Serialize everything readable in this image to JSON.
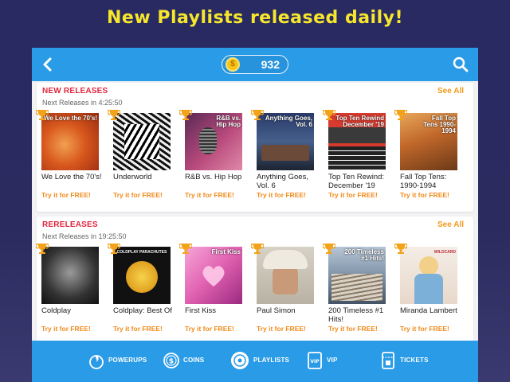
{
  "banner": {
    "text": "New Playlists released daily!"
  },
  "topbar": {
    "coins": "932",
    "coin_symbol": "$"
  },
  "sections": [
    {
      "title": "NEW RELEASES",
      "see_all": "See All",
      "next": "Next Releases in 4:25:50",
      "items": [
        {
          "title": "We Love the 70's!",
          "cta": "Try it for FREE!",
          "art": "We Love the 70's!"
        },
        {
          "title": "Underworld",
          "cta": "Try it for FREE!",
          "art": ""
        },
        {
          "title": "R&B vs. Hip Hop",
          "cta": "Try it for FREE!",
          "art": "R&B vs. Hip Hop"
        },
        {
          "title": "Anything Goes, Vol. 6",
          "cta": "Try it for FREE!",
          "art": "Anything Goes, Vol. 6"
        },
        {
          "title": "Top Ten Rewind: December '19",
          "cta": "Try it for FREE!",
          "art": "Top Ten Rewind December '19"
        },
        {
          "title": "Fall Top Tens: 1990-1994",
          "cta": "Try it for FREE!",
          "art": "Fall Top Tens 1990-1994"
        }
      ]
    },
    {
      "title": "RERELEASES",
      "see_all": "See All",
      "next": "Next Releases in 19:25:50",
      "items": [
        {
          "title": "Coldplay",
          "cta": "Try it for FREE!",
          "art": ""
        },
        {
          "title": "Coldplay: Best Of",
          "cta": "Try it for FREE!",
          "art": "COLDPLAY PARACHUTES"
        },
        {
          "title": "First Kiss",
          "cta": "Try it for FREE!",
          "art": "First Kiss"
        },
        {
          "title": "Paul Simon",
          "cta": "Try it for FREE!",
          "art": ""
        },
        {
          "title": "200 Timeless #1 Hits!",
          "cta": "Try it for FREE!",
          "art": "200 Timeless #1 Hits!"
        },
        {
          "title": "Miranda Lambert",
          "cta": "Try it for FREE!",
          "art": "WILDCARD"
        }
      ]
    }
  ],
  "bottom_nav": {
    "powerups": "POWERUPS",
    "coins": "COINS",
    "playlists": "PLAYLISTS",
    "vip": "VIP",
    "tickets": "TICKETS"
  },
  "colors": {
    "accent": "#2a9be6",
    "section_title": "#e0263e",
    "cta": "#f08a1a",
    "banner": "#f6e72c"
  }
}
